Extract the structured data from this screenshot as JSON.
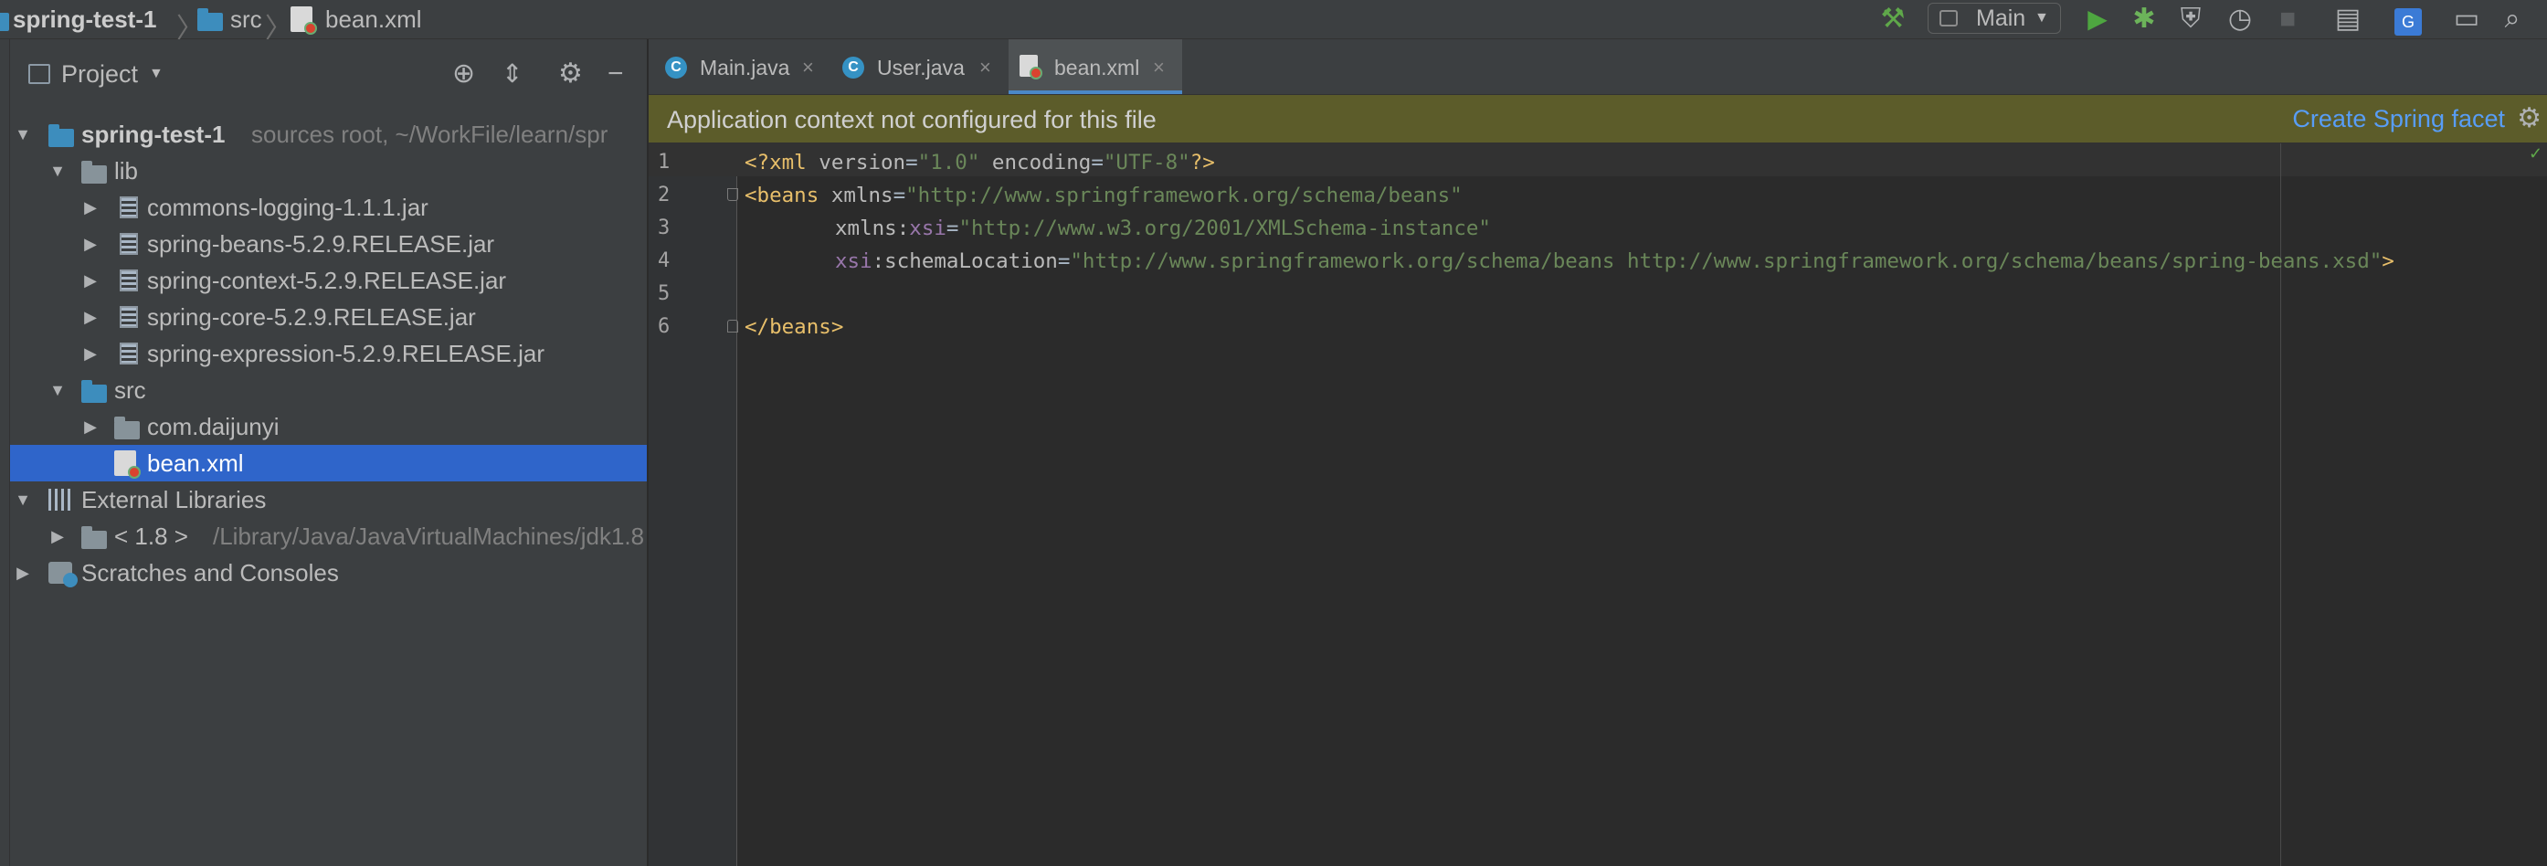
{
  "navbar": {
    "breadcrumbs": [
      "spring-test-1",
      "src",
      "bean.xml"
    ],
    "run_config": "Main"
  },
  "project_panel": {
    "title": "Project",
    "tree": [
      {
        "label": "spring-test-1",
        "suffix": "sources root,  ~/WorkFile/learn/spr",
        "type": "module",
        "expanded": true
      },
      {
        "label": "lib",
        "type": "folder",
        "expanded": true
      },
      {
        "label": "commons-logging-1.1.1.jar",
        "type": "jar"
      },
      {
        "label": "spring-beans-5.2.9.RELEASE.jar",
        "type": "jar"
      },
      {
        "label": "spring-context-5.2.9.RELEASE.jar",
        "type": "jar"
      },
      {
        "label": "spring-core-5.2.9.RELEASE.jar",
        "type": "jar"
      },
      {
        "label": "spring-expression-5.2.9.RELEASE.jar",
        "type": "jar"
      },
      {
        "label": "src",
        "type": "source-folder",
        "expanded": true
      },
      {
        "label": "com.daijunyi",
        "type": "package"
      },
      {
        "label": "bean.xml",
        "type": "xml",
        "selected": true
      },
      {
        "label": "External Libraries",
        "type": "libraries",
        "expanded": true
      },
      {
        "label": "< 1.8 >",
        "suffix": "/Library/Java/JavaVirtualMachines/jdk1.8",
        "type": "jdk"
      },
      {
        "label": "Scratches and Consoles",
        "type": "scratches"
      }
    ]
  },
  "editor": {
    "tabs": [
      {
        "label": "Main.java",
        "icon": "java-class-icon"
      },
      {
        "label": "User.java",
        "icon": "java-class-icon"
      },
      {
        "label": "bean.xml",
        "icon": "spring-xml-icon",
        "active": true
      }
    ],
    "banner": {
      "text": "Application context not configured for this file",
      "link": "Create Spring facet"
    },
    "line_numbers": [
      "1",
      "2",
      "3",
      "4",
      "5",
      "6"
    ],
    "code": {
      "l1": {
        "a": "<?xml ",
        "b": "version",
        "c": "=",
        "d": "\"1.0\"",
        "e": " encoding",
        "f": "=",
        "g": "\"UTF-8\"",
        "h": "?>"
      },
      "l2": {
        "a": "<beans ",
        "b": "xmlns",
        "c": "=",
        "d": "\"http://www.springframework.org/schema/beans\""
      },
      "l3": {
        "a": "xmlns",
        "b": ":",
        "c": "xsi",
        "d": "=",
        "e": "\"http://www.w3.org/2001/XMLSchema-instance\""
      },
      "l4": {
        "a": "xsi",
        "b": ":schemaLocation",
        "c": "=",
        "d": "\"http://www.springframework.org/schema/beans http://www.springframework.org/schema/beans/spring-beans.xsd\"",
        "e": ">"
      },
      "l6": {
        "a": "</beans>"
      }
    }
  },
  "colors": {
    "accent": "#2f65ca",
    "banner": "#5c5c2a",
    "link": "#589df6",
    "xml_tag": "#e8bf6a",
    "xml_value": "#6a8759"
  }
}
